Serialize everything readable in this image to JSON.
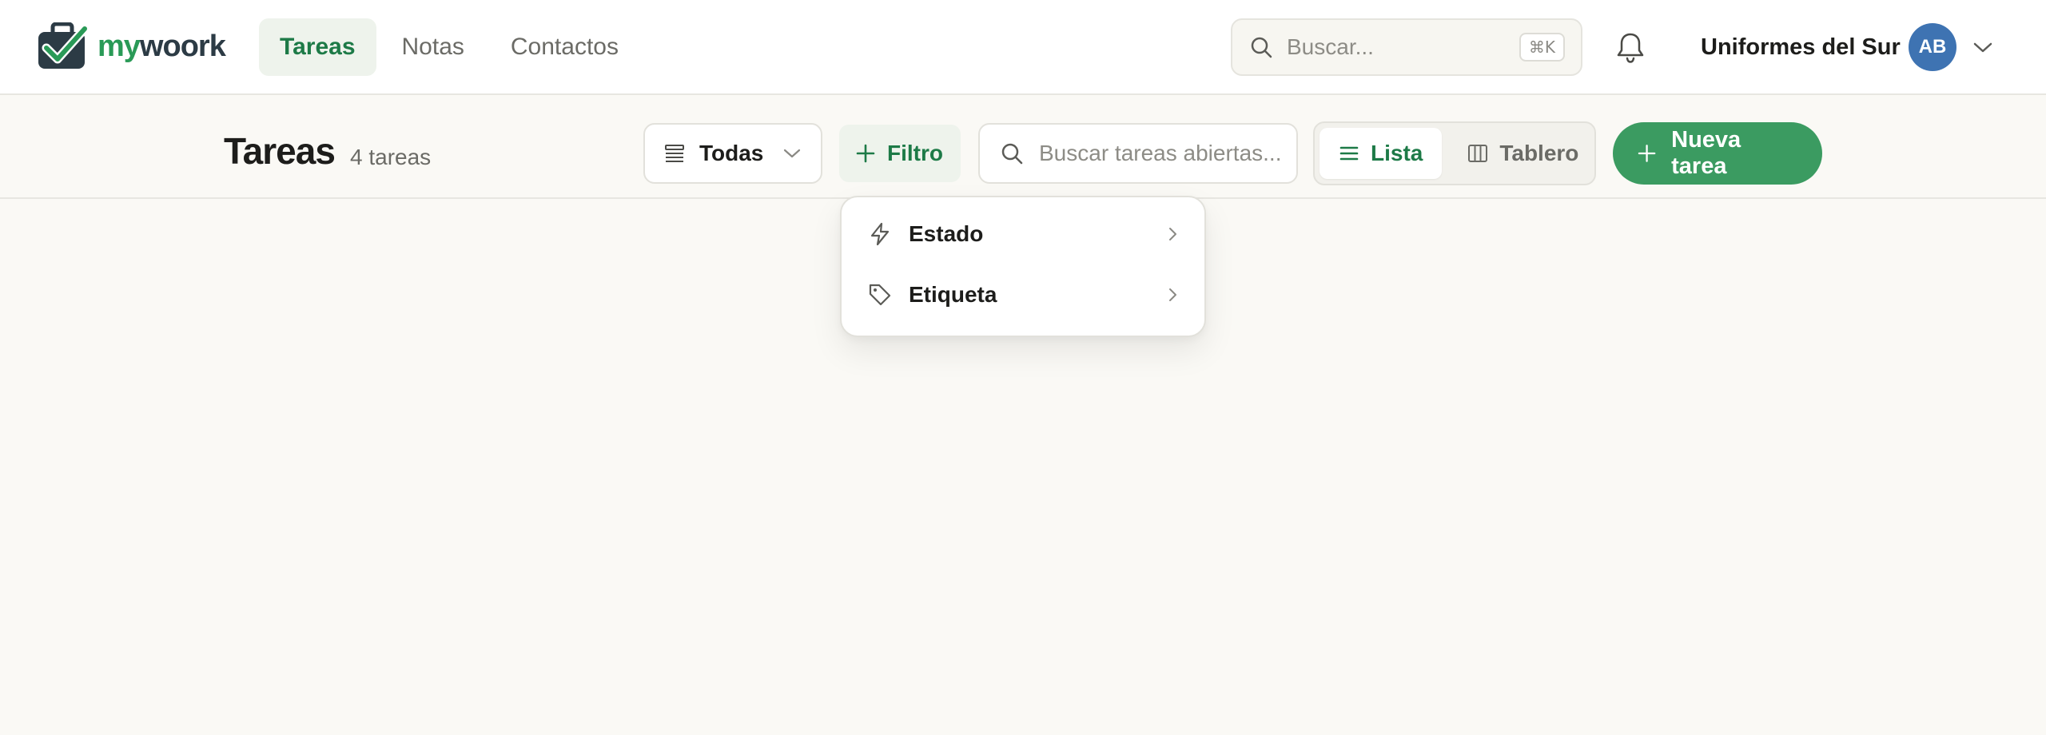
{
  "brand": {
    "logo_part1": "my",
    "logo_part2": "woork",
    "icon": "briefcase-check-icon",
    "colors": {
      "green": "#2a9a57",
      "dark": "#2c3b45"
    }
  },
  "nav": {
    "tabs": [
      {
        "label": "Tareas",
        "active": true
      },
      {
        "label": "Notas",
        "active": false
      },
      {
        "label": "Contactos",
        "active": false
      }
    ]
  },
  "global_search": {
    "placeholder": "Buscar...",
    "shortcut": "⌘K",
    "icon": "search-icon"
  },
  "header_right": {
    "bell_icon": "bell-icon",
    "org_name": "Uniformes del Sur",
    "avatar_initials": "AB",
    "avatar_color": "#3e73b2",
    "chevron_icon": "chevron-down-icon"
  },
  "toolbar": {
    "title": "Tareas",
    "count": "4 tareas",
    "scope_select": {
      "value": "Todas",
      "icon": "list-icon"
    },
    "filter_label": "Filtro",
    "search_placeholder": "Buscar tareas abiertas...",
    "views": [
      {
        "label": "Lista",
        "icon": "list-lines-icon",
        "active": true
      },
      {
        "label": "Tablero",
        "icon": "columns-icon",
        "active": false
      }
    ],
    "new_task_label": "Nueva tarea",
    "accent": "#3b9b61"
  },
  "filter_menu": {
    "items": [
      {
        "label": "Estado",
        "icon": "lightning-icon"
      },
      {
        "label": "Etiqueta",
        "icon": "tag-icon"
      }
    ]
  }
}
